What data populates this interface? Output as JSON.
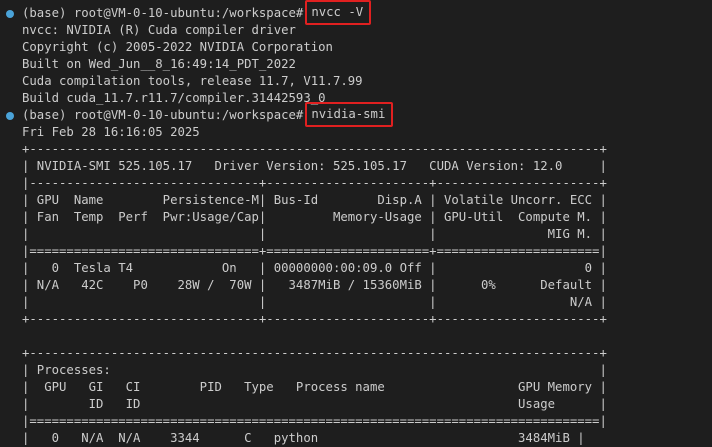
{
  "terminal": {
    "lines": [
      {
        "type": "prompt",
        "prompt": "(base) root@VM-0-10-ubuntu:/workspace#",
        "command": "nvcc -V"
      },
      {
        "type": "out",
        "text": "nvcc: NVIDIA (R) Cuda compiler driver"
      },
      {
        "type": "out",
        "text": "Copyright (c) 2005-2022 NVIDIA Corporation"
      },
      {
        "type": "out",
        "text": "Built on Wed_Jun__8_16:49:14_PDT_2022"
      },
      {
        "type": "out",
        "text": "Cuda compilation tools, release 11.7, V11.7.99"
      },
      {
        "type": "out",
        "text": "Build cuda_11.7.r11.7/compiler.31442593_0"
      },
      {
        "type": "prompt",
        "prompt": "(base) root@VM-0-10-ubuntu:/workspace#",
        "command": "nvidia-smi"
      },
      {
        "type": "out",
        "text": "Fri Feb 28 16:16:05 2025"
      },
      {
        "type": "out",
        "text": "+-----------------------------------------------------------------------------+"
      },
      {
        "type": "out",
        "text": "| NVIDIA-SMI 525.105.17   Driver Version: 525.105.17   CUDA Version: 12.0     |"
      },
      {
        "type": "out",
        "text": "|-------------------------------+----------------------+----------------------+"
      },
      {
        "type": "out",
        "text": "| GPU  Name        Persistence-M| Bus-Id        Disp.A | Volatile Uncorr. ECC |"
      },
      {
        "type": "out",
        "text": "| Fan  Temp  Perf  Pwr:Usage/Cap|         Memory-Usage | GPU-Util  Compute M. |"
      },
      {
        "type": "out",
        "text": "|                               |                      |               MIG M. |"
      },
      {
        "type": "out",
        "text": "|===============================+======================+======================|"
      },
      {
        "type": "out",
        "text": "|   0  Tesla T4            On   | 00000000:00:09.0 Off |                    0 |"
      },
      {
        "type": "out",
        "text": "| N/A   42C    P0    28W /  70W |   3487MiB / 15360MiB |      0%      Default |"
      },
      {
        "type": "out",
        "text": "|                               |                      |                  N/A |"
      },
      {
        "type": "out",
        "text": "+-------------------------------+----------------------+----------------------+"
      },
      {
        "type": "blank",
        "text": ""
      },
      {
        "type": "out",
        "text": "+-----------------------------------------------------------------------------+"
      },
      {
        "type": "out",
        "text": "| Processes:                                                                  |"
      },
      {
        "type": "out",
        "text": "|  GPU   GI   CI        PID   Type   Process name                  GPU Memory |"
      },
      {
        "type": "out",
        "text": "|        ID   ID                                                   Usage      |"
      },
      {
        "type": "out",
        "text": "|=============================================================================|"
      },
      {
        "type": "out",
        "text": "|   0   N/A  N/A    3344      C   python                           3484MiB |"
      }
    ]
  },
  "colors": {
    "background": "#1e1e1e",
    "text": "#cccccc",
    "prompt_dot": "#4aa3d8",
    "highlight_box": "#e02020"
  }
}
